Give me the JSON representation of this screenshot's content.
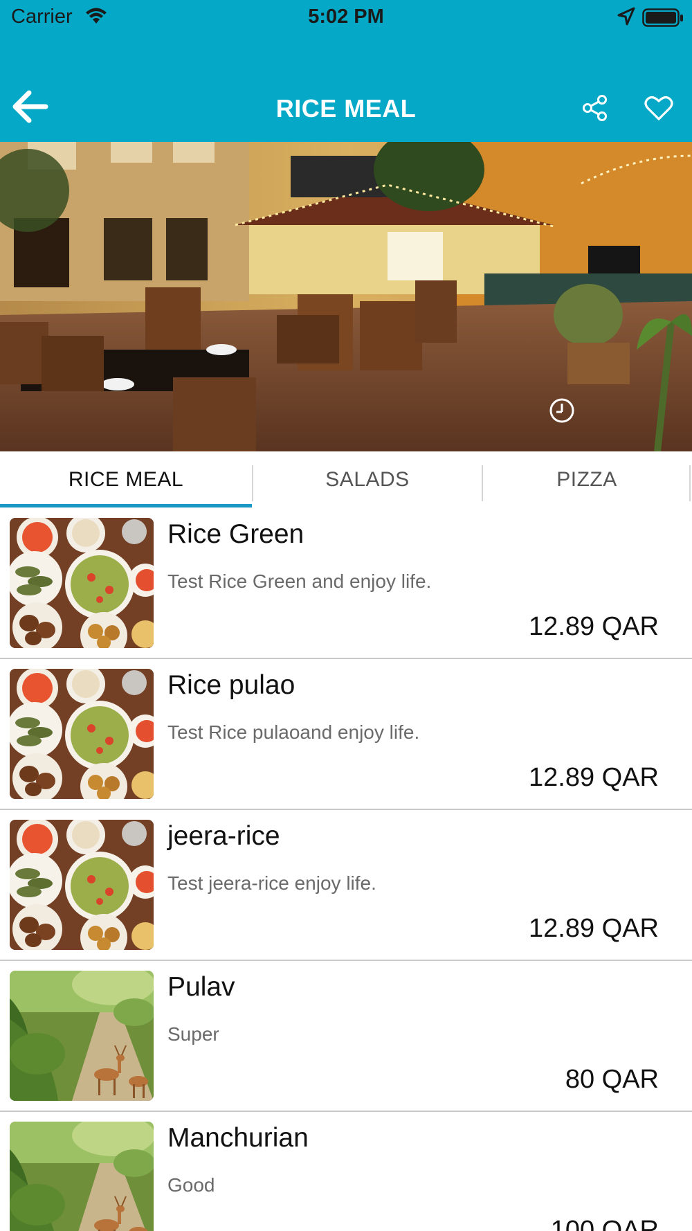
{
  "status_bar": {
    "carrier": "Carrier",
    "time": "5:02 PM"
  },
  "header": {
    "title": "RICE MEAL",
    "background_color": "#05a9c7",
    "icons": [
      "back-arrow-icon",
      "share-icon",
      "heart-icon"
    ]
  },
  "tabs": [
    {
      "label": "RICE MEAL",
      "active": true
    },
    {
      "label": "SALADS",
      "active": false
    },
    {
      "label": "PIZZA",
      "active": false
    }
  ],
  "accent_color": "#1a97c2",
  "menu_items": [
    {
      "name": "Rice Green",
      "description": "Test Rice Green and enjoy life.",
      "price": "12.89 QAR",
      "image": "food-platter"
    },
    {
      "name": "Rice pulao",
      "description": "Test Rice pulaoand enjoy life.",
      "price": "12.89 QAR",
      "image": "food-platter"
    },
    {
      "name": "jeera-rice",
      "description": "Test jeera-rice enjoy life.",
      "price": "12.89 QAR",
      "image": "food-platter"
    },
    {
      "name": "Pulav",
      "description": "Super",
      "price": "80 QAR",
      "image": "deer-forest"
    },
    {
      "name": "Manchurian",
      "description": "Good",
      "price": "100 QAR",
      "image": "deer-forest"
    }
  ]
}
